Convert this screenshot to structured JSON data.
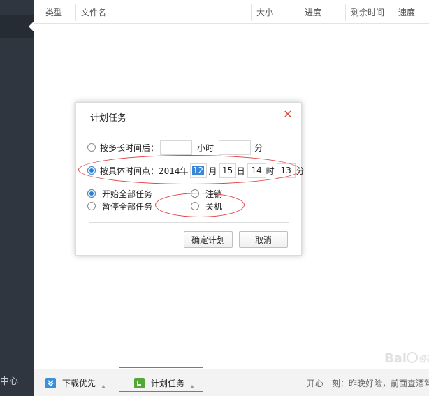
{
  "sidebar": {
    "bottom_label": "中心"
  },
  "columns": [
    "类型",
    "文件名",
    "大小",
    "进度",
    "剩余时间",
    "速度"
  ],
  "statusbar": {
    "download_priority": "下载优先",
    "scheduled_task": "计划任务",
    "tip": "开心一刻：昨晚好险，前面查酒驾",
    "watermark": "Bai♨经验"
  },
  "dialog": {
    "title": "计划任务",
    "close_glyph": "✕",
    "after_duration_label": "按多长时间后：",
    "hours_unit": "小时",
    "minutes_unit": "分",
    "at_time_label": "按具体时间点：2014年",
    "month": "12",
    "month_unit": "月",
    "day": "15",
    "day_unit": "日",
    "hour": "14",
    "hour_unit": "时",
    "minute": "13",
    "minute_unit2": "分",
    "start_all": "开始全部任务",
    "pause_all": "暂停全部任务",
    "logout": "注销",
    "shutdown": "关机",
    "confirm_button": "确定计划",
    "cancel_button": "取消"
  },
  "colors": {
    "sidebar": "#2f3640",
    "accent": "#2d7fd0",
    "annotation": "#e04040"
  },
  "icons": {
    "download_priority": "shield-down-icon",
    "scheduled_task": "clock-l-icon"
  }
}
